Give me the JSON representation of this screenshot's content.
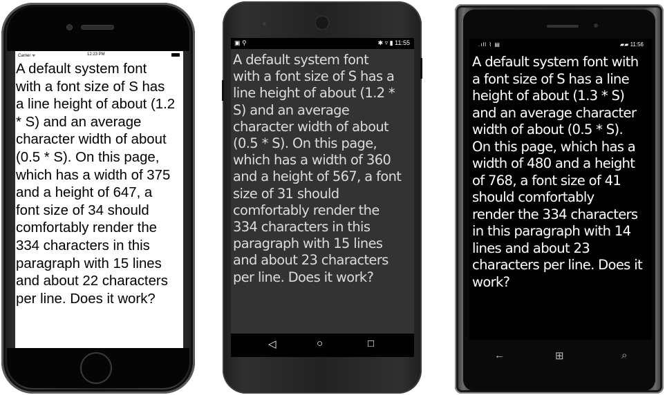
{
  "ios": {
    "carrier": "Carrier ᯤ",
    "time": "12:23 PM",
    "paragraph_lines": [
      "A default system font",
      "with a font size of S has",
      "a line height of about (1.2",
      "* S) and an average",
      "character width of about",
      "(0.5 * S). On this page,",
      "which has a width of 375",
      "and a height of 647, a",
      "font size of 34 should",
      "comfortably render the",
      "334 characters in this",
      "paragraph with 15 lines",
      "and about 22 characters",
      "per line. Does it work?"
    ]
  },
  "android": {
    "status_left": "▣ ⚲",
    "status_right": "✱ ▿ ▮ 11:55",
    "paragraph_lines": [
      "A default system font",
      "with a font size of S has a",
      "line height of about (1.2 *",
      "S) and an average",
      "character width of about",
      "(0.5 * S). On this page,",
      "which has a width of 360",
      "and a height of 567, a font",
      "size of 31 should",
      "comfortably render the",
      "334 characters in this",
      "paragraph with 15 lines",
      "and about 23 characters",
      "per line. Does it work?"
    ],
    "nav": {
      "back": "◁",
      "home": "○",
      "recents": "□"
    }
  },
  "windows": {
    "status_left": ".ıll ⌇ ▤",
    "status_right": "▰▰ 11:56",
    "paragraph_lines": [
      "A default system font with",
      "a font size of S has a line",
      "height of about (1.3 * S)",
      "and an average character",
      "width of about (0.5 * S).",
      "On this page, which has a",
      "width of 480 and a height",
      "of 768, a font size of 41",
      "should comfortably",
      "render the 334 characters",
      "in this paragraph with 14",
      "lines and about 23",
      "characters per line. Does it",
      "work?"
    ],
    "nav": {
      "back": "←",
      "start": "⊞",
      "search": "⌕"
    }
  }
}
